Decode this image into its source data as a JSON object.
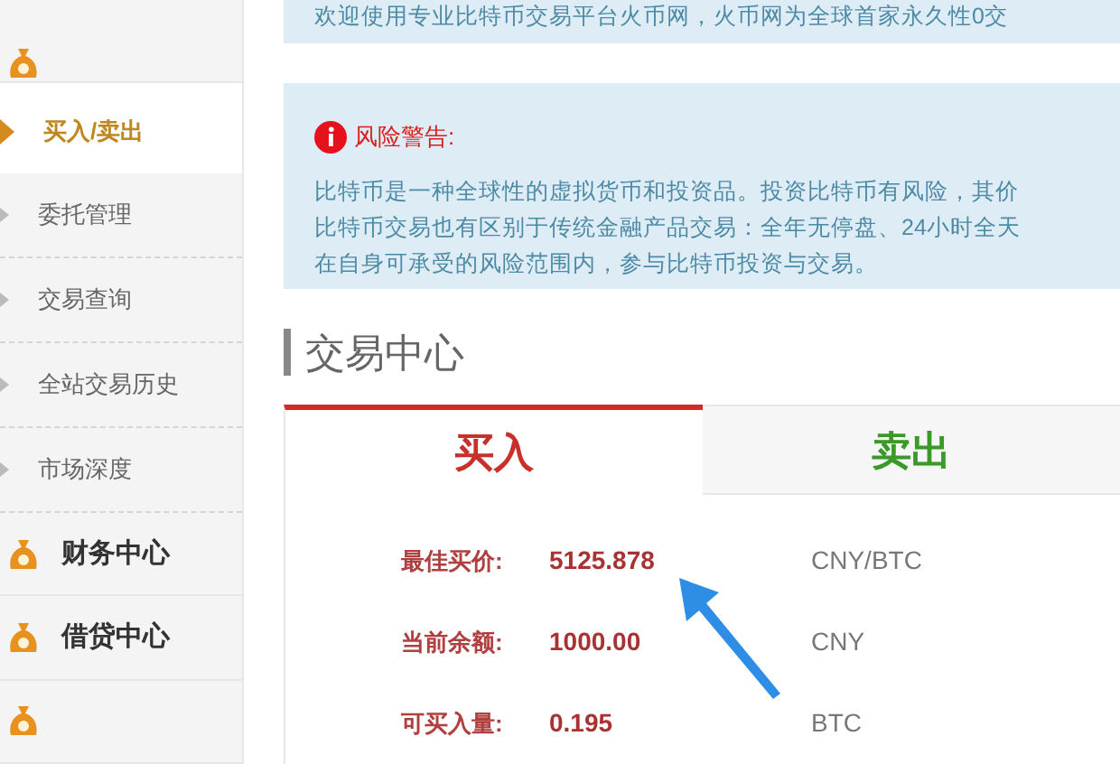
{
  "sidebar": {
    "items": [
      {
        "kind": "main",
        "selected": false
      },
      {
        "kind": "section",
        "label": "买入/卖出",
        "selected": true
      },
      {
        "kind": "sub",
        "label": "委托管理",
        "selected": false
      },
      {
        "kind": "sub",
        "label": "交易查询",
        "selected": false
      },
      {
        "kind": "sub",
        "label": "全站交易历史",
        "selected": false
      },
      {
        "kind": "sub",
        "label": "市场深度",
        "selected": false
      },
      {
        "kind": "main",
        "label": "财务中心",
        "selected": false
      },
      {
        "kind": "main",
        "label": "借贷中心",
        "selected": false
      },
      {
        "kind": "main",
        "selected": false
      }
    ]
  },
  "welcome": "欢迎使用专业比特币交易平台火币网，火币网为全球首家永久性0交",
  "warning": {
    "title": "风险警告:",
    "lines": [
      "比特币是一种全球性的虚拟货币和投资品。投资比特币有风险，其价",
      "比特币交易也有区别于传统金融产品交易：全年无停盘、24小时全天",
      "在自身可承受的风险范围内，参与比特币投资与交易。"
    ]
  },
  "section_title": "交易中心",
  "tabs": [
    {
      "label": "买入",
      "selected": true
    },
    {
      "label": "卖出",
      "selected": false
    }
  ],
  "rows": [
    {
      "label": "最佳买价:",
      "value": "5125.878",
      "unit": "CNY/BTC"
    },
    {
      "label": "当前余额:",
      "value": "1000.00",
      "unit": "CNY"
    },
    {
      "label": "可买入量:",
      "value": "0.195",
      "unit": "BTC"
    }
  ]
}
